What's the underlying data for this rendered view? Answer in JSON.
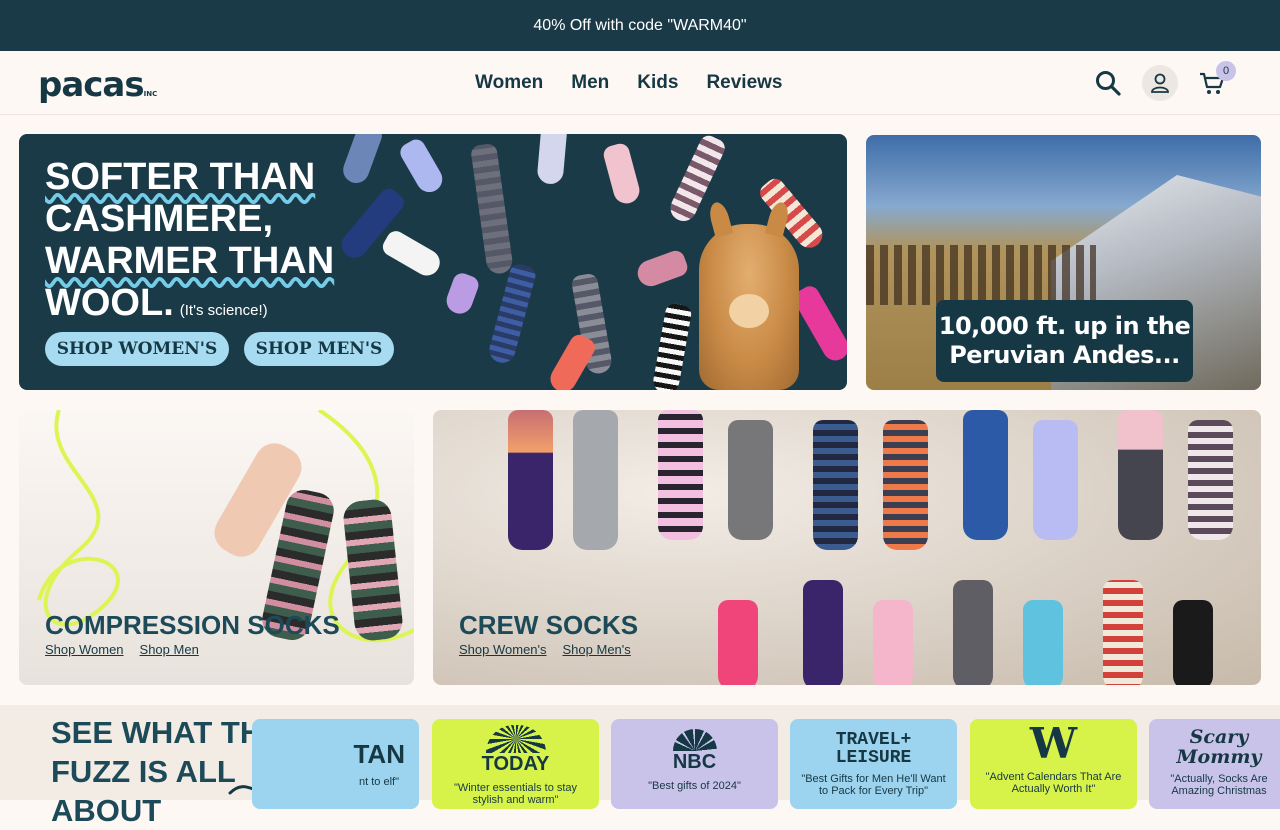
{
  "announcement": "40% Off with code \"WARM40\"",
  "logo": {
    "text": "pacas",
    "suffix": "INC"
  },
  "nav": [
    "Women",
    "Men",
    "Kids",
    "Reviews"
  ],
  "header": {
    "cart_count": "0",
    "icons": [
      "search-icon",
      "account-icon",
      "cart-icon"
    ]
  },
  "hero": {
    "line1": "SOFTER THAN",
    "line2": "CASHMERE,",
    "line3": "WARMER THAN",
    "line4": "WOOL.",
    "aside": "(It's science!)",
    "cta_women": "SHOP WOMEN'S",
    "cta_men": "SHOP MEN'S"
  },
  "side_banner": {
    "text": "10,000 ft. up in the Peruvian Andes..."
  },
  "compression": {
    "title": "COMPRESSION SOCKS",
    "link_women": "Shop Women",
    "link_men": "Shop Men"
  },
  "crew": {
    "title": "CREW SOCKS",
    "link_women": "Shop Women's",
    "link_men": "Shop Men's"
  },
  "fuzz": {
    "title": "SEE WHAT THE FUZZ IS ALL ABOUT"
  },
  "press": [
    {
      "brand": "TAN",
      "quote": "nt to elf\"",
      "color": "#9cd3ee"
    },
    {
      "brand": "TODAY",
      "quote": "\"Winter essentials to stay stylish and warm\"",
      "color": "#d7f34a"
    },
    {
      "brand": "NBC",
      "quote": "\"Best gifts of 2024\"",
      "color": "#c9c3ea"
    },
    {
      "brand": "TRAVEL+ LEISURE",
      "quote": "\"Best Gifts for Men He'll Want to Pack for Every Trip\"",
      "color": "#9cd3ee"
    },
    {
      "brand": "W",
      "quote": "\"Advent Calendars That Are Actually Worth It\"",
      "color": "#d7f34a"
    },
    {
      "brand": "Scary Mommy",
      "quote": "\"Actually, Socks Are Amazing Christmas",
      "color": "#c9c3ea"
    }
  ]
}
